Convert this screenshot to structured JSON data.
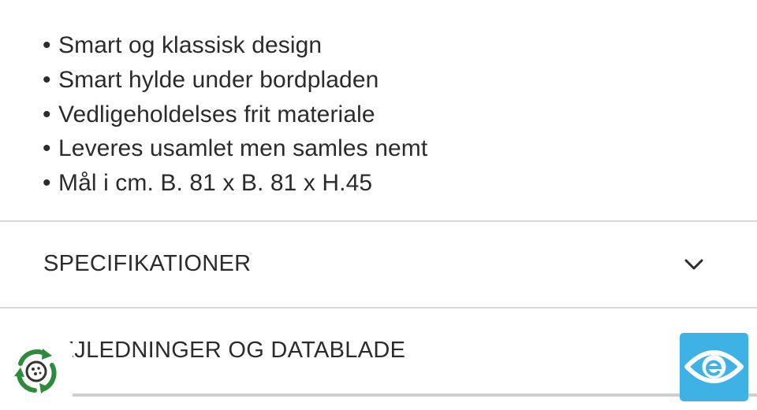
{
  "features": [
    {
      "bullet": "•",
      "text": "Smart og klassisk design"
    },
    {
      "bullet": "•",
      "text": "Smart hylde under bordpladen"
    },
    {
      "bullet": "•",
      "text": "Vedligeholdelses frit materiale"
    },
    {
      "bullet": "•",
      "text": "Leveres usamlet men samles nemt"
    },
    {
      "bullet": "•",
      "text": "Mål i cm. B. 81 x B. 81 x H.45"
    }
  ],
  "accordion": {
    "specifications": {
      "label": "SPECIFIKATIONER",
      "icon": "chevron-down-icon"
    },
    "guides": {
      "label": "VEJLEDNINGER OG DATABLADE"
    }
  },
  "badges": {
    "recycle": {
      "icon": "recycle-icon",
      "color": "#2e8b3e"
    },
    "accessibility": {
      "icon": "eye-icon",
      "color": "#3fb2e5"
    }
  }
}
